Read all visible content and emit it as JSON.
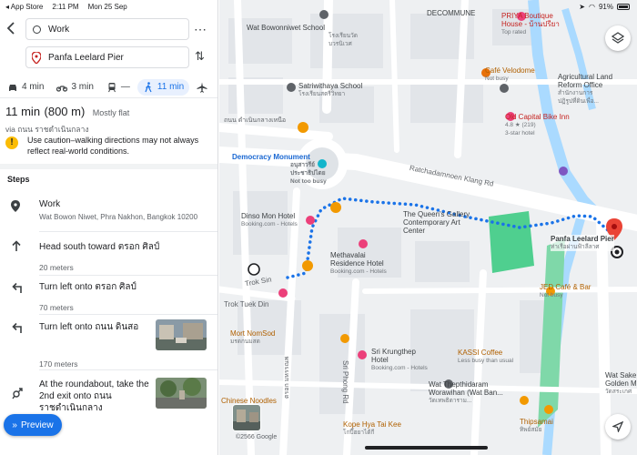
{
  "status_bar": {
    "back_app": "App Store",
    "time": "2:11 PM",
    "date": "Mon 25 Sep",
    "battery": "91%"
  },
  "route": {
    "origin": "Work",
    "destination": "Panfa Leelard Pier",
    "more_icon": "more-vert-icon",
    "swap_icon": "swap-icon"
  },
  "modes": [
    {
      "icon": "car-icon",
      "label": "4 min"
    },
    {
      "icon": "motorbike-icon",
      "label": "3 min"
    },
    {
      "icon": "transit-icon",
      "label": "—"
    },
    {
      "icon": "walk-icon",
      "label": "11 min"
    },
    {
      "icon": "flight-icon",
      "label": ""
    }
  ],
  "summary": {
    "time": "11 min",
    "distance": "(800 m)",
    "note": "Mostly flat",
    "via": "via ถนน ราชดำเนินกลาง"
  },
  "warning": "Use caution–walking directions may not always reflect real-world conditions.",
  "steps_title": "Steps",
  "steps": [
    {
      "icon": "pin-icon",
      "title": "Work",
      "subtitle": "Wat Bowon Niwet, Phra Nakhon, Bangkok 10200",
      "distance": ""
    },
    {
      "icon": "arrow-up-icon",
      "title": "Head south toward ตรอก ศิลป์",
      "subtitle": "",
      "distance": "20 meters"
    },
    {
      "icon": "turn-left-icon",
      "title": "Turn left onto ตรอก ศิลป์",
      "subtitle": "",
      "distance": "70 meters"
    },
    {
      "icon": "turn-left-icon",
      "title": "Turn left onto ถนน ดินสอ",
      "subtitle": "",
      "distance": "170 meters"
    },
    {
      "icon": "roundabout-icon",
      "title": "At the roundabout, take the 2nd exit onto ถนน ราชดำเนินกลาง",
      "subtitle": "",
      "distance": ""
    }
  ],
  "preview_label": "Preview",
  "map": {
    "labels": {
      "decommune": "DECOMMUNE",
      "priya": "PRIYA Boutique",
      "priya2": "House - บ้านปรียา",
      "priya_sub": "Top rated",
      "bowonniwet": "Wat Bowonniwet School",
      "bowonniwet_th": "โรงเรียนวัด",
      "bowonniwet_th2": "บวรนิเวศ",
      "cafe_velodome": "Café Velodome",
      "cafe_velodome_sub": "Not busy",
      "agri": "Agricultural Land",
      "agri2": "Reform Office",
      "agri_th": "สำนักงานการ",
      "agri_th2": "ปฏิรูปที่ดินเพื่อ...",
      "satri": "Satriwithaya School",
      "satri_th": "โรงเรียนสตรีวิทยา",
      "old_capital": "Old Capital Bike Inn",
      "old_capital_rating": "4.8 ★ (219)",
      "old_capital_sub": "3-star hotel",
      "democracy": "Democracy Monument",
      "democracy_th": "อนุสาวรีย์",
      "democracy_th2": "ประชาธิปไตย",
      "democracy_sub": "Not too busy",
      "road_north": "ถนน ดำเนินกลางเหนือ",
      "ratchadamnoen": "Ratchadamnoen Klang Rd",
      "dinso": "Dinso Mon Hotel",
      "dinso_sub": "Booking.com - Hotels",
      "queen": "The Queen's Gallery",
      "queen2": "Contemporary Art",
      "queen3": "Center",
      "methavalai": "Methavalai",
      "methavalai2": "Residence Hotel",
      "methavalai_sub": "Booking.com - Hotels",
      "panfa": "Panfa Leelard Pier",
      "panfa_th": "ท่าเรือผ่านฟ้าลีลาศ",
      "jed": "JED Café & Bar",
      "jed_sub": "Not busy",
      "trok_sin": "Trok Sin",
      "trok_tuek": "Trok Tuek Din",
      "mort": "Mort NomSod",
      "mort_th": "มรดกนมสด",
      "sri": "Sri Krungthep",
      "sri2": "Hotel",
      "sri_sub": "Booking.com - Hotels",
      "kassi": "KASSI Coffee",
      "kassi_sub": "Less busy than usual",
      "thepthidaram": "Wat Thepthidaram",
      "thepthidaram2": "Worawihan (Wat Ban...",
      "thepthidaram_th": "วัดเทพธิดาราม...",
      "phong_road": "Sri Phong Rd",
      "mahannop": "ตรอก มหรรณพ",
      "kope": "Kope Hya Tai Kee",
      "kope_th": "โกปี๊ฮยาไต้กี",
      "thipsamai": "Thipsamai",
      "thipsamai_th": "ทิพย์สมัย",
      "chinese_noodles": "Chinese Noodles",
      "saket": "Wat Sake",
      "saket2": "Golden M",
      "saket_th": "วัดสระเกศ",
      "copyright": "©2566 Google"
    }
  }
}
